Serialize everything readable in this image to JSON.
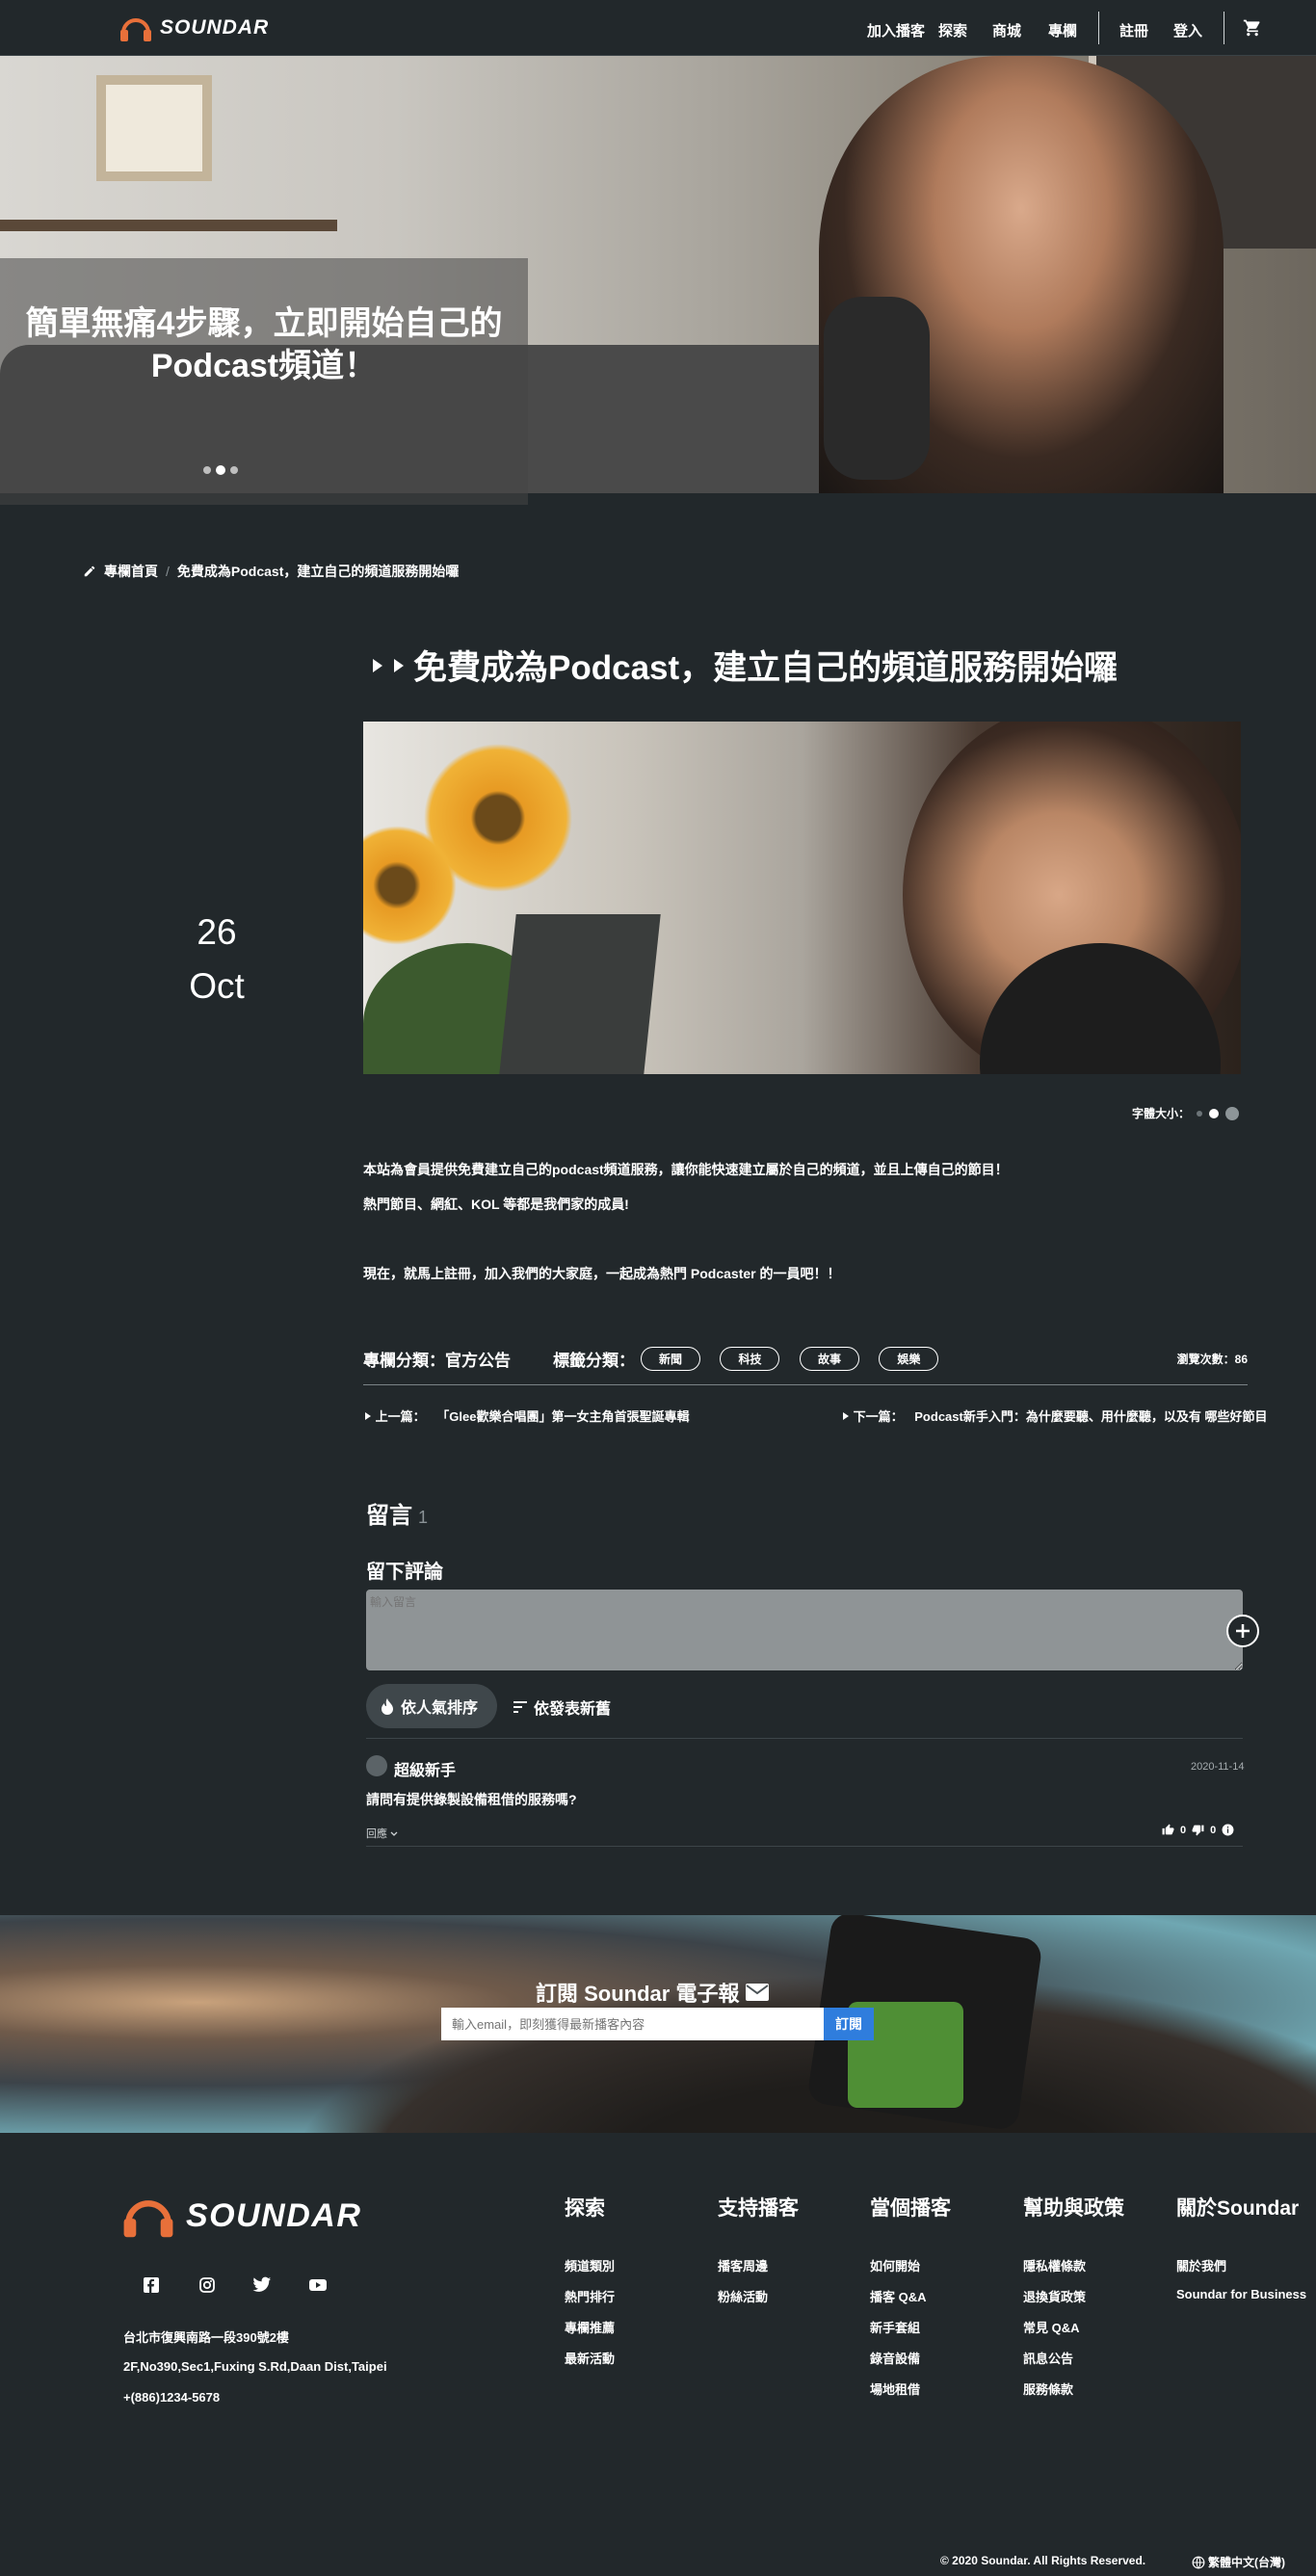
{
  "header": {
    "brand": "SOUNDAR",
    "nav": {
      "join": "加入播客",
      "explore": "探索",
      "shop": "商城",
      "column": "專欄",
      "register": "註冊",
      "login": "登入"
    }
  },
  "hero": {
    "title_line1": "簡單無痛4步驟，立即開始自己的",
    "title_line2": "Podcast頻道！",
    "slides": 3,
    "active_slide": 2
  },
  "breadcrumb": {
    "home": "專欄首頁",
    "separator": "/",
    "current": "免費成為Podcast，建立自己的頻道服務開始囉"
  },
  "article": {
    "day": "26",
    "month": "Oct",
    "title": "免費成為Podcast，建立自己的頻道服務開始囉",
    "font_size_label": "字體大小：",
    "paragraph1": "本站為會員提供免費建立自己的podcast頻道服務，讓你能快速建立屬於自己的頻道，並且上傳自己的節目！",
    "paragraph2": "熱門節目、網紅、KOL 等都是我們家的成員!",
    "paragraph3": "現在，就馬上註冊，加入我們的大家庭，一起成為熱門 Podcaster 的一員吧！！",
    "category_label": "專欄分類：",
    "category": "官方公告",
    "tags_label": "標籤分類：",
    "tags": [
      "新聞",
      "科技",
      "故事",
      "娛樂"
    ],
    "views": "瀏覽次數：86",
    "prev_label": "上一篇：",
    "prev_title": "「Glee歡樂合唱團」第一女主角首張聖誕專輯",
    "next_label": "下一篇：",
    "next_title": "Podcast新手入門：為什麼要聽、用什麼聽，以及有 哪些好節目"
  },
  "comments": {
    "title": "留言",
    "count": "1",
    "leave_title": "留下評論",
    "input_placeholder": "輸入留言",
    "sort_popular": "依人氣排序",
    "sort_newest": "依發表新舊",
    "items": [
      {
        "user": "超級新手",
        "date": "2020-11-14",
        "text": "請問有提供錄製設備租借的服務嗎?",
        "reply": "回應",
        "likes": "0",
        "dislikes": "0"
      }
    ]
  },
  "newsletter": {
    "title": "訂閱 Soundar 電子報",
    "placeholder": "輸入email，即刻獲得最新播客內容",
    "button": "訂閱"
  },
  "footer": {
    "brand": "SOUNDAR",
    "address_zh": "台北市復興南路一段390號2樓",
    "address_en": "2F,No390,Sec1,Fuxing S.Rd,Daan Dist,Taipei",
    "phone": "+(886)1234-5678",
    "columns": [
      {
        "title": "探索",
        "links": [
          "頻道類別",
          "熱門排行",
          "專欄推薦",
          "最新活動"
        ]
      },
      {
        "title": "支持播客",
        "links": [
          "播客周邊",
          "粉絲活動"
        ]
      },
      {
        "title": "當個播客",
        "links": [
          "如何開始",
          "播客 Q&A",
          "新手套組",
          "錄音設備",
          "場地租借"
        ]
      },
      {
        "title": "幫助與政策",
        "links": [
          "隱私權條款",
          "退換貨政策",
          "常見 Q&A",
          "訊息公告",
          "服務條款"
        ]
      },
      {
        "title": "關於Soundar",
        "links": [
          "關於我們",
          "Soundar for Business"
        ]
      }
    ],
    "copyright": "© 2020 Soundar. All Rights Reserved.",
    "language": "繁體中文(台灣)"
  },
  "colors": {
    "background": "#22282b",
    "brand_orange": "#e8703a",
    "subscribe_blue": "#2f7ddd"
  }
}
